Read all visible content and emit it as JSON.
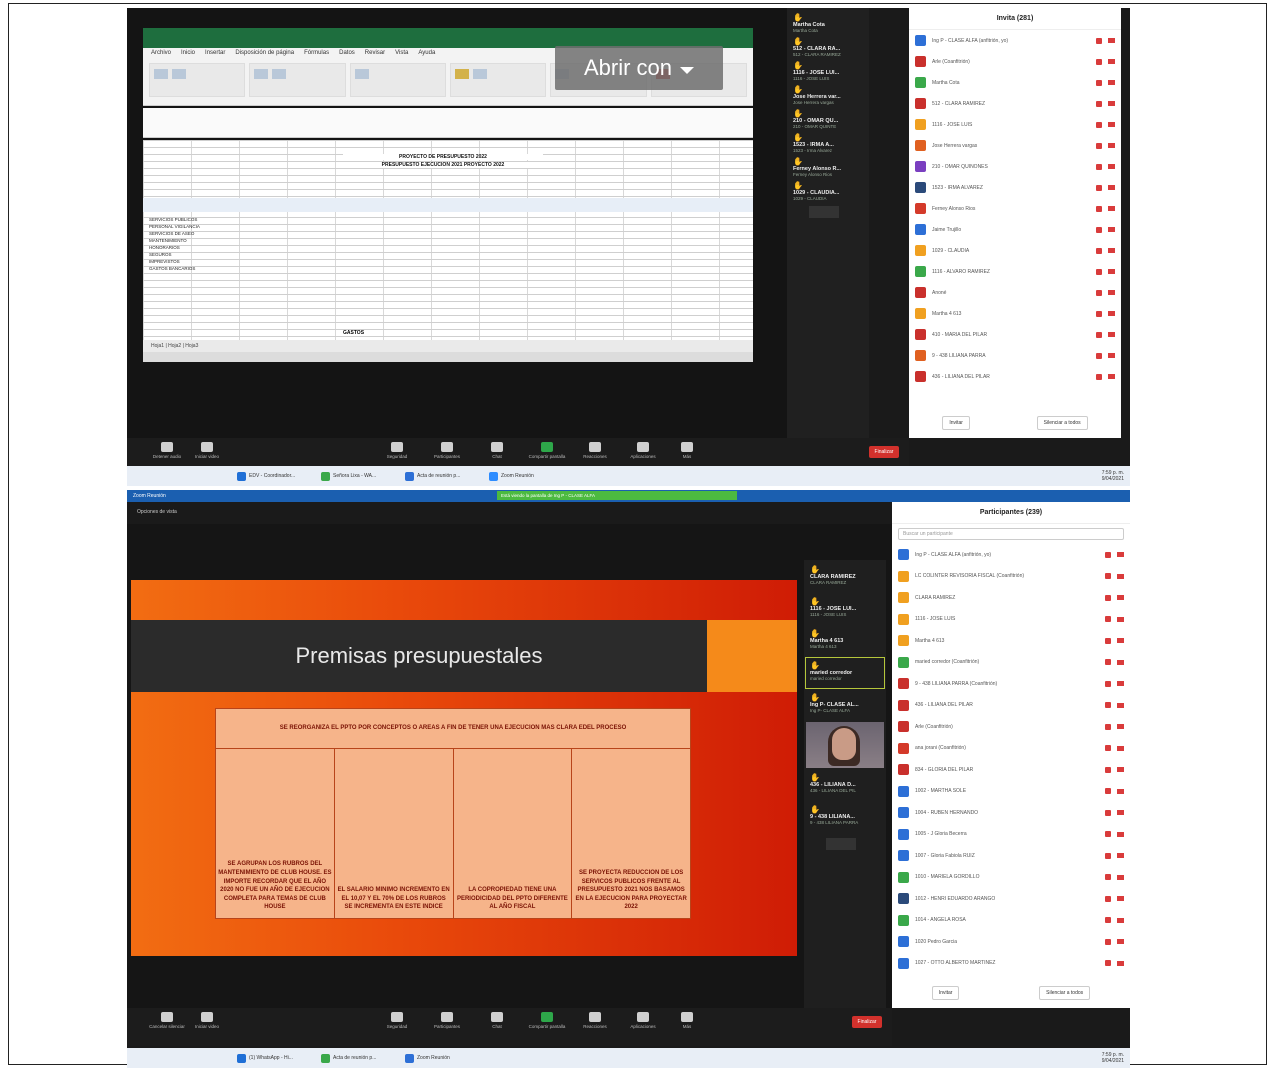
{
  "shot1": {
    "excel_title": "",
    "ribbon_tabs": [
      "Archivo",
      "Inicio",
      "Insertar",
      "Disposición de página",
      "Fórmulas",
      "Datos",
      "Revisar",
      "Vista",
      "Ayuda"
    ],
    "formula_value": "",
    "sheet_header_1": "PROYECTO DE PRESUPUESTO 2022",
    "sheet_header_2": "PRESUPUESTO EJECUCION 2021 PROYECTO 2022",
    "sheet_rows": "SERVICIOS PUBLICOS\nPERSONAL VIGILANCIA\nSERVICIOS DE ASEO\nMANTENIMIENTO\nHONORARIOS\nSEGUROS\nIMPREVISTOS\nGASTOS BANCARIOS",
    "sheet_total_label": "GASTOS",
    "sheet_tabs": "Hoja1  |  Hoja2  |  Hoja3",
    "open_with_label": "Abrir con",
    "gallery": [
      {
        "name": "Martha Cota",
        "sub": "Martha Cota"
      },
      {
        "name": "512 - CLARA RA...",
        "sub": "512 - CLARA RAMIREZ"
      },
      {
        "name": "1116 - JOSE LUI...",
        "sub": "1116 - JOSE LUIS"
      },
      {
        "name": "Jose Herrera var...",
        "sub": "Jose Herrera vargas"
      },
      {
        "name": "210 - OMAR QU...",
        "sub": "210 - OMAR QUINTE"
      },
      {
        "name": "1523 - IRMA A...",
        "sub": "1523 - Irma Alvarez"
      },
      {
        "name": "Ferney Alonso R...",
        "sub": "Ferney Alonso Rios"
      },
      {
        "name": "1029 - CLAUDIA...",
        "sub": "1029 - CLAUDIA"
      }
    ],
    "panel_title": "Invita (281)",
    "participants": [
      {
        "name": "Ing P - CLASE ALFA (anfitrión, yo)",
        "color": "#2d6fd6"
      },
      {
        "name": "Arle (Coanfitrión)",
        "color": "#c9302c"
      },
      {
        "name": "Martha Cota",
        "color": "#3aa84a"
      },
      {
        "name": "512 - CLARA RAMIREZ",
        "color": "#c9302c"
      },
      {
        "name": "1116 - JOSE LUIS",
        "color": "#f0a020"
      },
      {
        "name": "Jose Herrera vargas",
        "color": "#e06020"
      },
      {
        "name": "210 - OMAR QUIÑONES",
        "color": "#7a3fc0"
      },
      {
        "name": "1523 - IRMA ALVAREZ",
        "color": "#2b4a7a"
      },
      {
        "name": "Ferney Alonso Rios",
        "color": "#d43a2a"
      },
      {
        "name": "Jaime Trujillo",
        "color": "#2d6fd6"
      },
      {
        "name": "1029 - CLAUDIA",
        "color": "#f0a020"
      },
      {
        "name": "1116 - ALVARO RAMIREZ",
        "color": "#3aa84a"
      },
      {
        "name": "Anoné",
        "color": "#c9302c"
      },
      {
        "name": "Martha 4 613",
        "color": "#f0a020"
      },
      {
        "name": "410 - MARIA DEL PILAR",
        "color": "#c9302c"
      },
      {
        "name": "9 - 438 LILIANA PARRA",
        "color": "#e06020"
      },
      {
        "name": "436 - LILIANA DEL PILAR",
        "color": "#c9302c"
      }
    ],
    "panel_invite": "Invitar",
    "panel_mute_all": "Silenciar a todos",
    "toolbar": [
      "Detener audio",
      "Iniciar video",
      "Seguridad",
      "Participantes",
      "Chat",
      "Compartir pantalla",
      "Reacciones",
      "Aplicaciones",
      "Más"
    ],
    "end_label": "Finalizar",
    "taskbar_items": [
      "EDV - Coordinador...",
      "Señora Lixa - WA...",
      "Acta de reunión p...",
      "Zoom Reunión"
    ],
    "clock": "7:59 p. m.\n9/04/2021"
  },
  "shot2": {
    "window_title": "Zoom Reunión",
    "banner": "Está viendo la pantalla de Ing P - CLASE ALFA",
    "view_label": "Opciones de vista",
    "slide_title": "Premisas presupuestales",
    "table_header": "SE REORGANIZA EL PPTO POR CONCEPTOS O AREAS A FIN DE TENER UNA EJECUCION MAS CLARA EDEL PROCESO",
    "table_cells": [
      "SE AGRUPAN LOS RUBROS DEL MANTENIMIENTO DE CLUB HOUSE. ES IMPORTE RECORDAR QUE EL AÑO 2020 NO FUE UN AÑO DE EJECUCION COMPLETA PARA TEMAS DE CLUB HOUSE",
      "EL SALARIO MINIMO INCREMENTO EN EL 10,07 Y EL 70% DE LOS RUBROS SE INCREMENTA EN ESTE INDICE",
      "LA COPROPIEDAD TIENE UNA PERIODICIDAD DEL PPTO DIFERENTE AL AÑO FISCAL",
      "SE PROYECTA REDUCCION DE LOS SERVICOS PUBLICOS FRENTE AL PRESUPUESTO 2021 NOS BASAMOS EN LA EJECUCION PARA PROYECTAR 2022"
    ],
    "gallery": [
      {
        "name": "CLARA RAMIREZ",
        "sub": "CLARA RAMIREZ"
      },
      {
        "name": "1116 - JOSE LUI...",
        "sub": "1116 - JOSE LUIS"
      },
      {
        "name": "Martha 4 613",
        "sub": "Martha 4 613"
      },
      {
        "name": "maried corredor",
        "sub": "maried corredor"
      },
      {
        "name": "Ing P- CLASE AL...",
        "sub": "Ing P- CLASE ALFA"
      },
      {
        "name": "436 - LILIANA D...",
        "sub": "436 - LILIANA DEL PIL"
      },
      {
        "name": "9 - 438 LILIANA...",
        "sub": "9 - 438 LILIANA PARRA"
      }
    ],
    "panel_title": "Participantes (239)",
    "search_placeholder": "Buscar un participante",
    "participants": [
      {
        "name": "Ing P - CLASE ALFA (anfitrión, yo)",
        "color": "#2d6fd6"
      },
      {
        "name": "LC COLINTER REVISORIA FISCAL (Coanfitrión)",
        "color": "#f0a020"
      },
      {
        "name": "CLARA RAMIREZ",
        "color": "#f0a020"
      },
      {
        "name": "1116 - JOSE LUIS",
        "color": "#f0a020"
      },
      {
        "name": "Martha 4 613",
        "color": "#f0a020"
      },
      {
        "name": "maried corredor (Coanfitrión)",
        "color": "#3aa84a"
      },
      {
        "name": "9 - 438 LILIANA PARRA (Coanfitrión)",
        "color": "#c9302c"
      },
      {
        "name": "436 - LILIANA DEL PILAR",
        "color": "#c9302c"
      },
      {
        "name": "Arle (Coanfitrión)",
        "color": "#c9302c"
      },
      {
        "name": "ana jorani (Coanfitrión)",
        "color": "#d43a2a"
      },
      {
        "name": "834 - GLORIA DEL PILAR",
        "color": "#c9302c"
      },
      {
        "name": "1002 - MARTHA SOLE",
        "color": "#2d6fd6"
      },
      {
        "name": "1004 - RUBEN HERNANDO",
        "color": "#2d6fd6"
      },
      {
        "name": "1005 - J Gloria Becerra",
        "color": "#2d6fd6"
      },
      {
        "name": "1007 - Gloria Fabiola RUIZ",
        "color": "#2d6fd6"
      },
      {
        "name": "1010 - MARIELA GORDILLO",
        "color": "#3aa84a"
      },
      {
        "name": "1012 - HENRI EDUARDO ARANGO",
        "color": "#2b4a7a"
      },
      {
        "name": "1014 - ANGELA ROSA",
        "color": "#3aa84a"
      },
      {
        "name": "1020 Pedro Garcia",
        "color": "#2d6fd6"
      },
      {
        "name": "1027 - OTTO ALBERTO MARTINEZ",
        "color": "#2d6fd6"
      }
    ],
    "panel_invite": "Invitar",
    "panel_mute_all": "Silenciar a todos",
    "toolbar": [
      "Cancelar silenciar",
      "Iniciar video",
      "Seguridad",
      "Participantes",
      "Chat",
      "Compartir pantalla",
      "Reacciones",
      "Aplicaciones",
      "Más"
    ],
    "end_label": "Finalizar",
    "taskbar_items": [
      "(1) WhatsApp - Hi...",
      "Acta de reunión p...",
      "Zoom Reunión"
    ],
    "clock": "7:59 p. m.\n9/04/2021"
  }
}
